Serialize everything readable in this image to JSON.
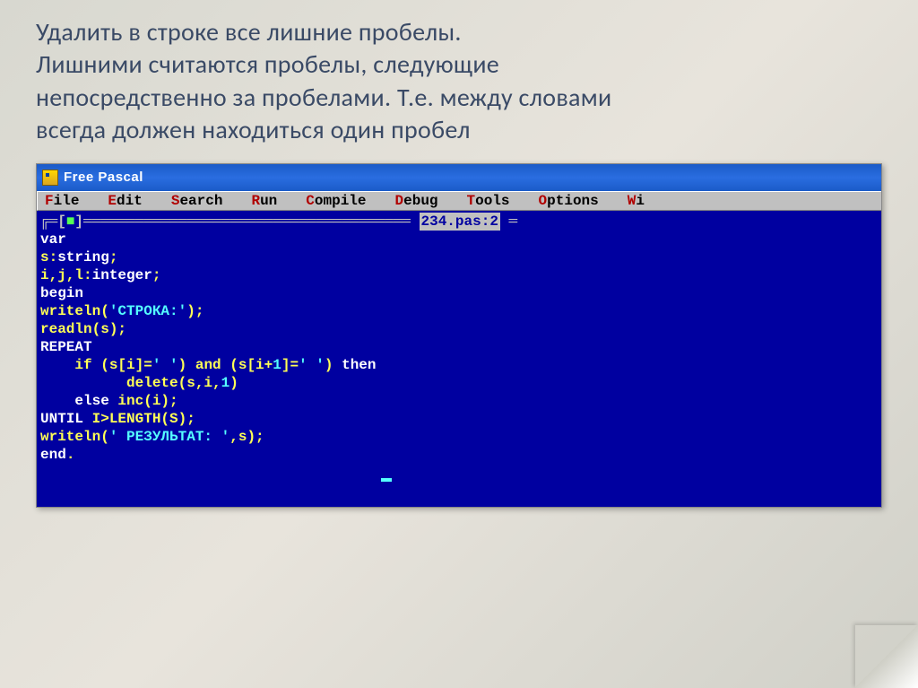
{
  "task": {
    "line1": "Удалить в строке все лишние пробелы.",
    "line2": "Лишними считаются пробелы, следующие",
    "line3": "непосредственно за пробелами. Т.е. между словами",
    "line4": "всегда должен находиться один пробел"
  },
  "window": {
    "title": "Free Pascal",
    "filename": "234.pas:2"
  },
  "menu": {
    "file": {
      "hot": "F",
      "rest": "ile"
    },
    "edit": {
      "hot": "E",
      "rest": "dit"
    },
    "search": {
      "hot": "S",
      "rest": "earch"
    },
    "run": {
      "hot": "R",
      "rest": "un"
    },
    "compile": {
      "hot": "C",
      "rest": "ompile"
    },
    "debug": {
      "hot": "D",
      "rest": "ebug"
    },
    "tools": {
      "hot": "T",
      "rest": "ools"
    },
    "options": {
      "hot": "O",
      "rest": "ptions"
    },
    "window": {
      "hot": "W",
      "rest": "i"
    }
  },
  "frame": {
    "left": "╔═[",
    "sqopen": "■",
    "mid1": "]════",
    "mid2": "══════════════════════════════════ ",
    "tail": " ═"
  },
  "code": {
    "l1_kw": "var",
    "l2_id": "s:",
    "l2_ty": "string",
    "l2_sc": ";",
    "l3_id": "i,j,l:",
    "l3_ty": "integer",
    "l3_sc": ";",
    "l4_kw": "begin",
    "l5_fn": "writeln(",
    "l5_str": "'СТРОКА:'",
    "l5_close": ");",
    "l6_fn": "readln(s);",
    "l7_kw": "REPEAT",
    "l8_pre": "    if (s[i]=",
    "l8_s1": "' '",
    "l8_mid": ") and (s[i+",
    "l8_num1": "1",
    "l8_mid2": "]=",
    "l8_s2": "' '",
    "l8_close": ") ",
    "l8_then": "then",
    "l9_pre": "          delete(s,i,",
    "l9_num": "1",
    "l9_close": ")",
    "l10_pre": "    ",
    "l10_else": "else",
    "l10_rest": " inc(i);",
    "l11_until": "UNTIL",
    "l11_rest": " I>LENGTH(S);",
    "l12_fn": "writeln(",
    "l12_str": "' РЕЗУЛЬТАТ: '",
    "l12_rest": ",s);",
    "l13_kw": "end",
    "l13_dot": "."
  }
}
